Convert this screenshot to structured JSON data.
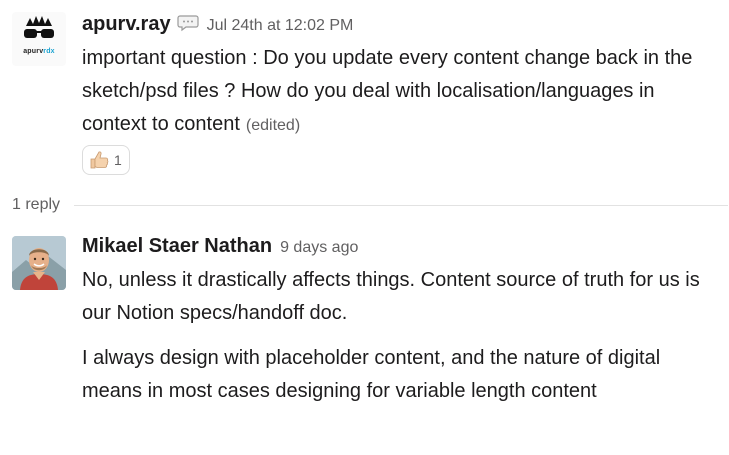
{
  "thread": {
    "parent": {
      "author": "apurv.ray",
      "avatar_text": "apurvrdx",
      "avatar_text_main": "apurv",
      "avatar_text_accent": "rdx",
      "status_icon": "speech-bubble-icon",
      "timestamp": "Jul 24th at 12:02 PM",
      "text": "important question : Do you update every content change back in the sketch/psd files ? How do you deal with localisation/languages in context to content",
      "edited_label": "(edited)",
      "reaction": {
        "emoji": "thumbs-up-icon",
        "count": "1"
      }
    },
    "reply_count_label": "1 reply",
    "reply": {
      "author": "Mikael Staer Nathan",
      "timestamp": "9 days ago",
      "paragraphs": [
        "No, unless it drastically affects things. Content source of truth for us is our Notion specs/handoff doc.",
        "I always design with placeholder content, and the nature of digital means in most cases designing for variable length content"
      ]
    }
  },
  "colors": {
    "text": "#1d1c1d",
    "muted": "#616061",
    "divider": "#e2e2e2",
    "accent": "#1aa3d1"
  }
}
